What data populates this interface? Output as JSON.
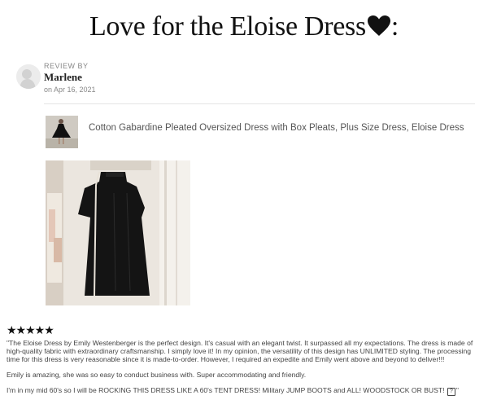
{
  "page": {
    "title": "Love for the Eloise Dress",
    "title_suffix": ":"
  },
  "review": {
    "label": "REVIEW BY",
    "reviewer": "Marlene",
    "date": "on Apr 16, 2021",
    "product_title": "Cotton Gabardine Pleated Oversized Dress with Box Pleats, Plus Size Dress, Eloise Dress",
    "rating": 5,
    "stars": "★★★★★",
    "text_p1": "\"The Eloise Dress by Emily Westenberger is the perfect design. It's casual with an elegant twist. It surpassed all my expectations. The dress is made of high-quality fabric with extraordinary craftsmanship. I simply love it! In my opinion, the versatility of this design has UNLIMITED styling. The processing time for this dress is very reasonable since it is made-to-order. However, I required an expedite and Emily went above and beyond to deliver!!!",
    "text_p2": "Emily is amazing, she was so easy to conduct business with. Super accommodating and friendly.",
    "text_p3": "I'm in my mid 60's so I will be ROCKING THIS DRESS LIKE A 60's TENT DRESS! Military JUMP BOOTS and ALL! WOODSTOCK OR BUST!",
    "text_p3_glyph": "?",
    "text_p3_end": "\""
  },
  "icons": {
    "heart": "black-heart-icon",
    "avatar": "user-avatar-icon",
    "star": "star-icon"
  },
  "colors": {
    "title": "#111111",
    "meta": "#888888",
    "body": "#444444",
    "divider": "#e4e4e4"
  }
}
